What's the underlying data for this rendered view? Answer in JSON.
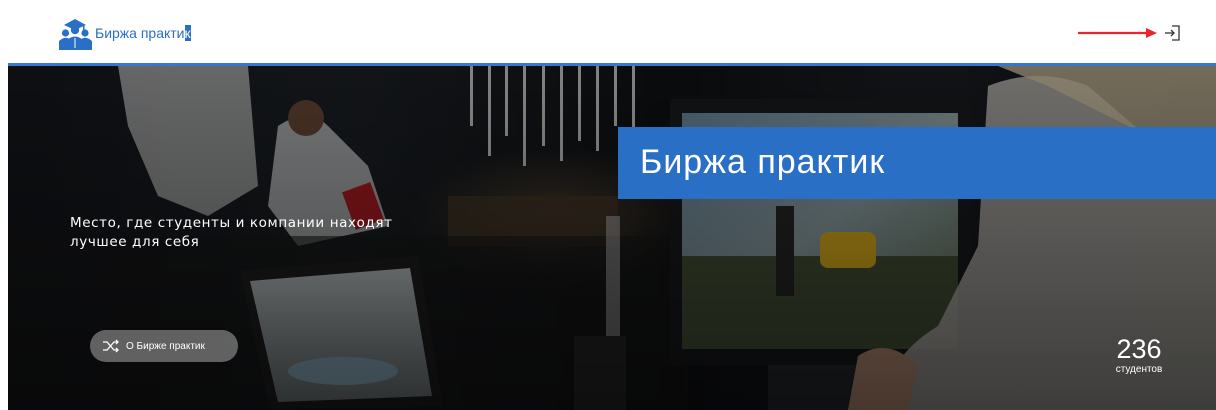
{
  "header": {
    "logo_text_main": "Биржа практи",
    "logo_text_selected": "к"
  },
  "hero": {
    "title": "Биржа практик",
    "tagline_line1": "Место, где студенты и компании находят",
    "tagline_line2": "лучшее для себя",
    "about_button_label": "О Бирже практик",
    "stat_value": "236",
    "stat_label": "студентов"
  },
  "colors": {
    "brand": "#2a6fc6",
    "header_line": "#3479cf",
    "annotation_arrow": "#e8262b"
  },
  "icons": {
    "logo": "people-logo-icon",
    "login": "login-icon",
    "about": "shuffle-icon"
  }
}
